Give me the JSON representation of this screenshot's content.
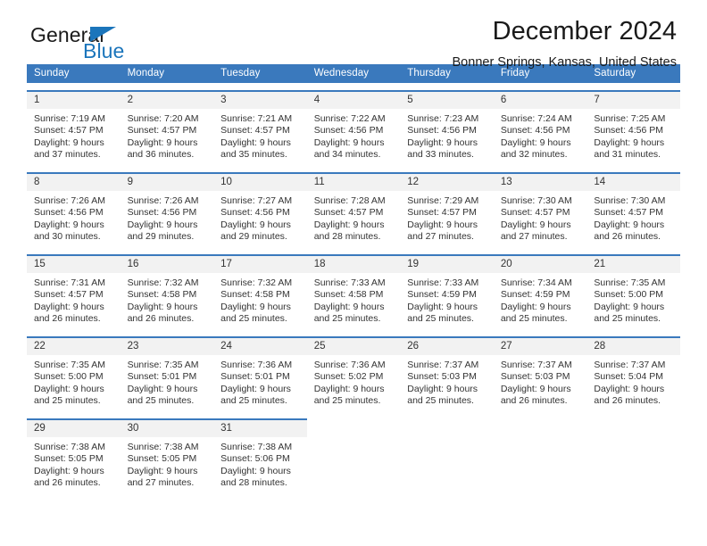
{
  "brand": {
    "name_top": "General",
    "name_bottom": "Blue",
    "accent_color": "#1b75bb",
    "triangle_icon": "triangle-icon"
  },
  "header": {
    "title": "December 2024",
    "subtitle": "Bonner Springs, Kansas, United States"
  },
  "calendar": {
    "header_color": "#3a79bd",
    "daynum_background": "#f2f2f2",
    "weekdays": [
      "Sunday",
      "Monday",
      "Tuesday",
      "Wednesday",
      "Thursday",
      "Friday",
      "Saturday"
    ],
    "weeks": [
      [
        {
          "day": "1",
          "sunrise": "Sunrise: 7:19 AM",
          "sunset": "Sunset: 4:57 PM",
          "daylight_1": "Daylight: 9 hours",
          "daylight_2": "and 37 minutes."
        },
        {
          "day": "2",
          "sunrise": "Sunrise: 7:20 AM",
          "sunset": "Sunset: 4:57 PM",
          "daylight_1": "Daylight: 9 hours",
          "daylight_2": "and 36 minutes."
        },
        {
          "day": "3",
          "sunrise": "Sunrise: 7:21 AM",
          "sunset": "Sunset: 4:57 PM",
          "daylight_1": "Daylight: 9 hours",
          "daylight_2": "and 35 minutes."
        },
        {
          "day": "4",
          "sunrise": "Sunrise: 7:22 AM",
          "sunset": "Sunset: 4:56 PM",
          "daylight_1": "Daylight: 9 hours",
          "daylight_2": "and 34 minutes."
        },
        {
          "day": "5",
          "sunrise": "Sunrise: 7:23 AM",
          "sunset": "Sunset: 4:56 PM",
          "daylight_1": "Daylight: 9 hours",
          "daylight_2": "and 33 minutes."
        },
        {
          "day": "6",
          "sunrise": "Sunrise: 7:24 AM",
          "sunset": "Sunset: 4:56 PM",
          "daylight_1": "Daylight: 9 hours",
          "daylight_2": "and 32 minutes."
        },
        {
          "day": "7",
          "sunrise": "Sunrise: 7:25 AM",
          "sunset": "Sunset: 4:56 PM",
          "daylight_1": "Daylight: 9 hours",
          "daylight_2": "and 31 minutes."
        }
      ],
      [
        {
          "day": "8",
          "sunrise": "Sunrise: 7:26 AM",
          "sunset": "Sunset: 4:56 PM",
          "daylight_1": "Daylight: 9 hours",
          "daylight_2": "and 30 minutes."
        },
        {
          "day": "9",
          "sunrise": "Sunrise: 7:26 AM",
          "sunset": "Sunset: 4:56 PM",
          "daylight_1": "Daylight: 9 hours",
          "daylight_2": "and 29 minutes."
        },
        {
          "day": "10",
          "sunrise": "Sunrise: 7:27 AM",
          "sunset": "Sunset: 4:56 PM",
          "daylight_1": "Daylight: 9 hours",
          "daylight_2": "and 29 minutes."
        },
        {
          "day": "11",
          "sunrise": "Sunrise: 7:28 AM",
          "sunset": "Sunset: 4:57 PM",
          "daylight_1": "Daylight: 9 hours",
          "daylight_2": "and 28 minutes."
        },
        {
          "day": "12",
          "sunrise": "Sunrise: 7:29 AM",
          "sunset": "Sunset: 4:57 PM",
          "daylight_1": "Daylight: 9 hours",
          "daylight_2": "and 27 minutes."
        },
        {
          "day": "13",
          "sunrise": "Sunrise: 7:30 AM",
          "sunset": "Sunset: 4:57 PM",
          "daylight_1": "Daylight: 9 hours",
          "daylight_2": "and 27 minutes."
        },
        {
          "day": "14",
          "sunrise": "Sunrise: 7:30 AM",
          "sunset": "Sunset: 4:57 PM",
          "daylight_1": "Daylight: 9 hours",
          "daylight_2": "and 26 minutes."
        }
      ],
      [
        {
          "day": "15",
          "sunrise": "Sunrise: 7:31 AM",
          "sunset": "Sunset: 4:57 PM",
          "daylight_1": "Daylight: 9 hours",
          "daylight_2": "and 26 minutes."
        },
        {
          "day": "16",
          "sunrise": "Sunrise: 7:32 AM",
          "sunset": "Sunset: 4:58 PM",
          "daylight_1": "Daylight: 9 hours",
          "daylight_2": "and 26 minutes."
        },
        {
          "day": "17",
          "sunrise": "Sunrise: 7:32 AM",
          "sunset": "Sunset: 4:58 PM",
          "daylight_1": "Daylight: 9 hours",
          "daylight_2": "and 25 minutes."
        },
        {
          "day": "18",
          "sunrise": "Sunrise: 7:33 AM",
          "sunset": "Sunset: 4:58 PM",
          "daylight_1": "Daylight: 9 hours",
          "daylight_2": "and 25 minutes."
        },
        {
          "day": "19",
          "sunrise": "Sunrise: 7:33 AM",
          "sunset": "Sunset: 4:59 PM",
          "daylight_1": "Daylight: 9 hours",
          "daylight_2": "and 25 minutes."
        },
        {
          "day": "20",
          "sunrise": "Sunrise: 7:34 AM",
          "sunset": "Sunset: 4:59 PM",
          "daylight_1": "Daylight: 9 hours",
          "daylight_2": "and 25 minutes."
        },
        {
          "day": "21",
          "sunrise": "Sunrise: 7:35 AM",
          "sunset": "Sunset: 5:00 PM",
          "daylight_1": "Daylight: 9 hours",
          "daylight_2": "and 25 minutes."
        }
      ],
      [
        {
          "day": "22",
          "sunrise": "Sunrise: 7:35 AM",
          "sunset": "Sunset: 5:00 PM",
          "daylight_1": "Daylight: 9 hours",
          "daylight_2": "and 25 minutes."
        },
        {
          "day": "23",
          "sunrise": "Sunrise: 7:35 AM",
          "sunset": "Sunset: 5:01 PM",
          "daylight_1": "Daylight: 9 hours",
          "daylight_2": "and 25 minutes."
        },
        {
          "day": "24",
          "sunrise": "Sunrise: 7:36 AM",
          "sunset": "Sunset: 5:01 PM",
          "daylight_1": "Daylight: 9 hours",
          "daylight_2": "and 25 minutes."
        },
        {
          "day": "25",
          "sunrise": "Sunrise: 7:36 AM",
          "sunset": "Sunset: 5:02 PM",
          "daylight_1": "Daylight: 9 hours",
          "daylight_2": "and 25 minutes."
        },
        {
          "day": "26",
          "sunrise": "Sunrise: 7:37 AM",
          "sunset": "Sunset: 5:03 PM",
          "daylight_1": "Daylight: 9 hours",
          "daylight_2": "and 25 minutes."
        },
        {
          "day": "27",
          "sunrise": "Sunrise: 7:37 AM",
          "sunset": "Sunset: 5:03 PM",
          "daylight_1": "Daylight: 9 hours",
          "daylight_2": "and 26 minutes."
        },
        {
          "day": "28",
          "sunrise": "Sunrise: 7:37 AM",
          "sunset": "Sunset: 5:04 PM",
          "daylight_1": "Daylight: 9 hours",
          "daylight_2": "and 26 minutes."
        }
      ],
      [
        {
          "day": "29",
          "sunrise": "Sunrise: 7:38 AM",
          "sunset": "Sunset: 5:05 PM",
          "daylight_1": "Daylight: 9 hours",
          "daylight_2": "and 26 minutes."
        },
        {
          "day": "30",
          "sunrise": "Sunrise: 7:38 AM",
          "sunset": "Sunset: 5:05 PM",
          "daylight_1": "Daylight: 9 hours",
          "daylight_2": "and 27 minutes."
        },
        {
          "day": "31",
          "sunrise": "Sunrise: 7:38 AM",
          "sunset": "Sunset: 5:06 PM",
          "daylight_1": "Daylight: 9 hours",
          "daylight_2": "and 28 minutes."
        },
        {
          "day": "",
          "sunrise": "",
          "sunset": "",
          "daylight_1": "",
          "daylight_2": ""
        },
        {
          "day": "",
          "sunrise": "",
          "sunset": "",
          "daylight_1": "",
          "daylight_2": ""
        },
        {
          "day": "",
          "sunrise": "",
          "sunset": "",
          "daylight_1": "",
          "daylight_2": ""
        },
        {
          "day": "",
          "sunrise": "",
          "sunset": "",
          "daylight_1": "",
          "daylight_2": ""
        }
      ]
    ]
  }
}
